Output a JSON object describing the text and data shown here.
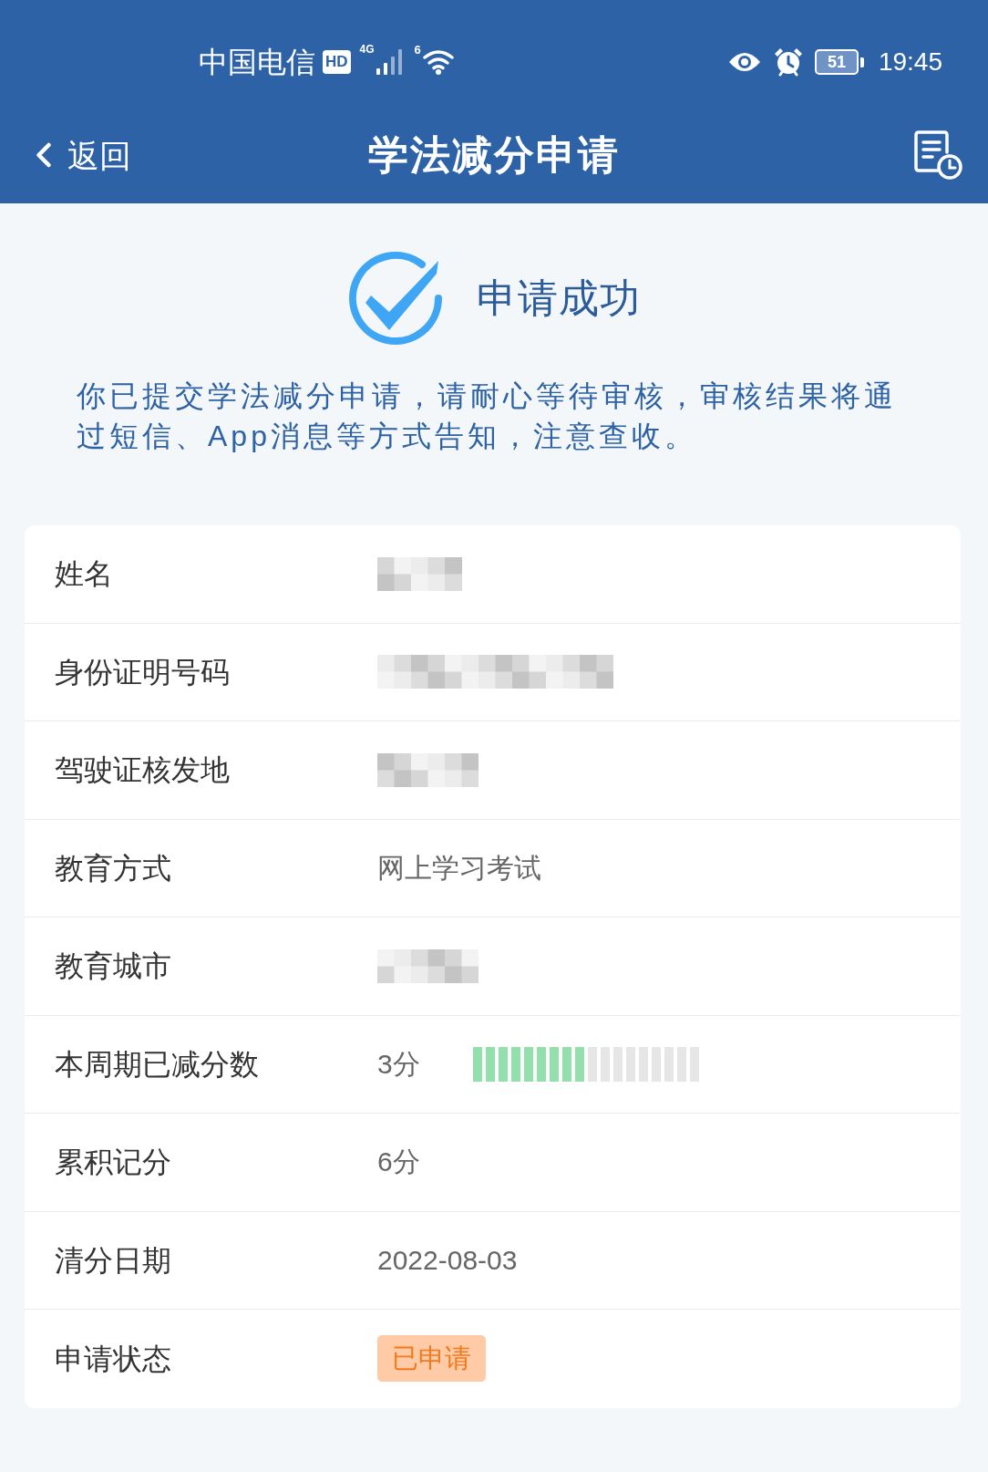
{
  "status_bar": {
    "carrier": "中国电信",
    "hd": "HD",
    "network": "4G",
    "wifi_label": "6",
    "battery": "51",
    "time": "19:45"
  },
  "header": {
    "back": "返回",
    "title": "学法减分申请"
  },
  "result": {
    "title": "申请成功",
    "message": "你已提交学法减分申请，请耐心等待审核，审核结果将通过短信、App消息等方式告知，注意查收。"
  },
  "rows": [
    {
      "kind": "redacted",
      "label": "姓名"
    },
    {
      "kind": "redacted",
      "label": "身份证明号码"
    },
    {
      "kind": "redacted",
      "label": "驾驶证核发地"
    },
    {
      "kind": "text",
      "label": "教育方式",
      "value": "网上学习考试"
    },
    {
      "kind": "redacted",
      "label": "教育城市"
    },
    {
      "kind": "meter",
      "label": "本周期已减分数",
      "value": "3分",
      "level": 0.5
    },
    {
      "kind": "text",
      "label": "累积记分",
      "value": "6分"
    },
    {
      "kind": "text",
      "label": "清分日期",
      "value": "2022-08-03"
    },
    {
      "kind": "badge",
      "label": "申请状态",
      "value": "已申请"
    }
  ]
}
